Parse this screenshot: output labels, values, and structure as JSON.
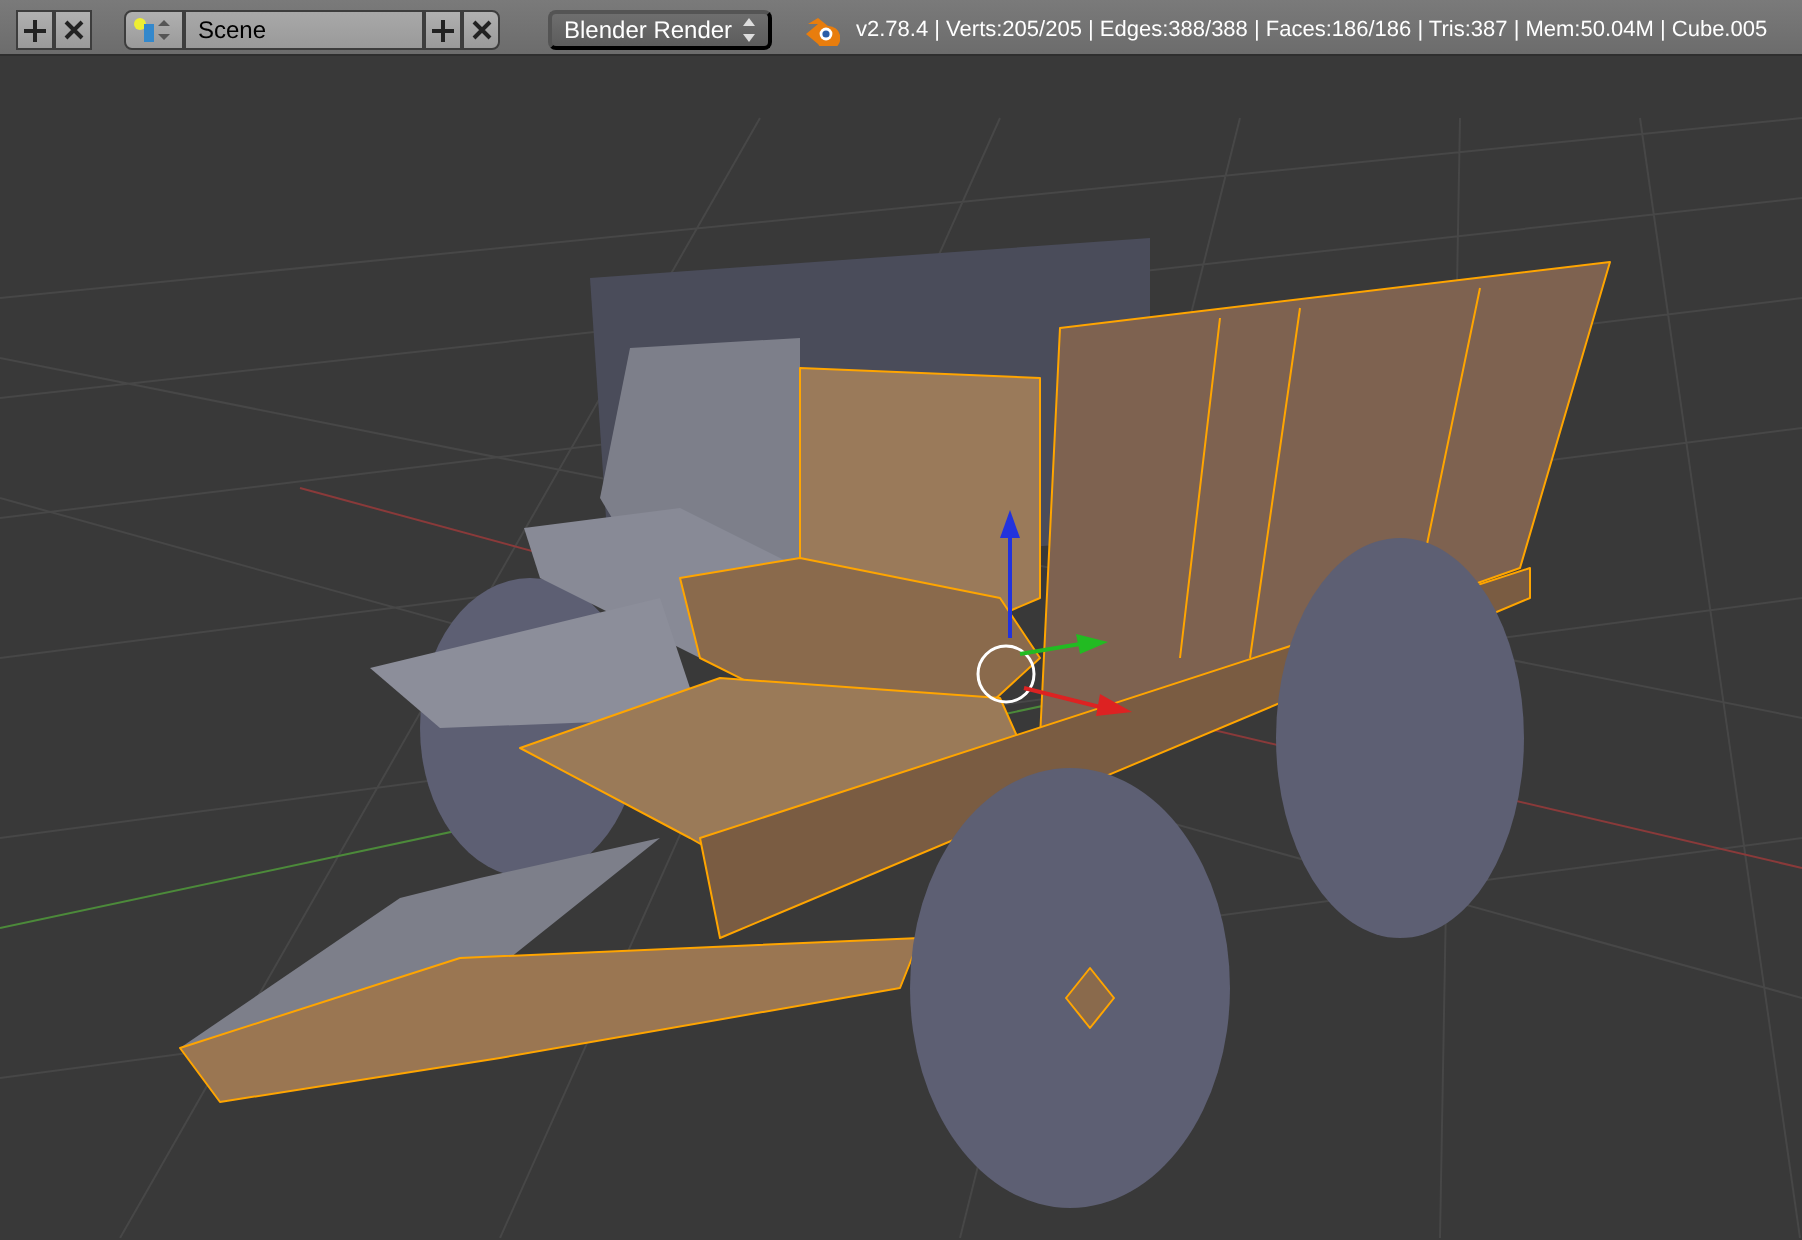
{
  "header": {
    "scene_name": "Scene",
    "render_engine": "Blender Render",
    "stats": "v2.78.4 | Verts:205/205 | Edges:388/388 | Faces:186/186 | Tris:387 | Mem:50.04M | Cube.005"
  }
}
